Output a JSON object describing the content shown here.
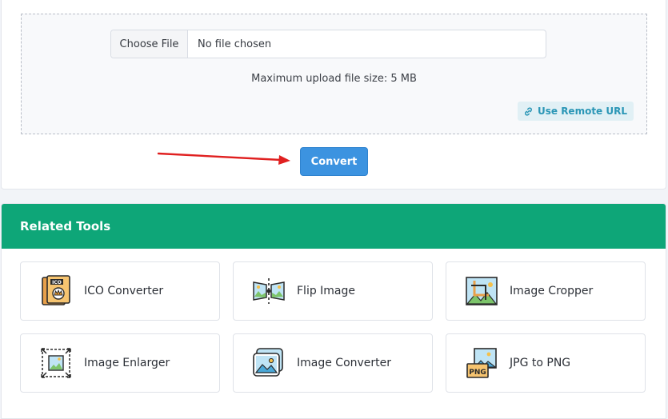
{
  "upload": {
    "choose_file_label": "Choose File",
    "file_status": "No file chosen",
    "max_size_text": "Maximum upload file size: 5 MB",
    "remote_url_label": "Use Remote URL",
    "convert_label": "Convert"
  },
  "related": {
    "title": "Related Tools",
    "tools": [
      {
        "label": "ICO Converter",
        "icon": "ico-file-icon"
      },
      {
        "label": "Flip Image",
        "icon": "flip-image-icon"
      },
      {
        "label": "Image Cropper",
        "icon": "crop-icon"
      },
      {
        "label": "Image Enlarger",
        "icon": "enlarge-icon"
      },
      {
        "label": "Image Converter",
        "icon": "image-converter-icon"
      },
      {
        "label": "JPG to PNG",
        "icon": "png-file-icon"
      }
    ]
  },
  "colors": {
    "accent_green": "#0ea678",
    "button_blue": "#3c93e0",
    "link_teal": "#2a96b6",
    "arrow_red": "#e02020"
  }
}
